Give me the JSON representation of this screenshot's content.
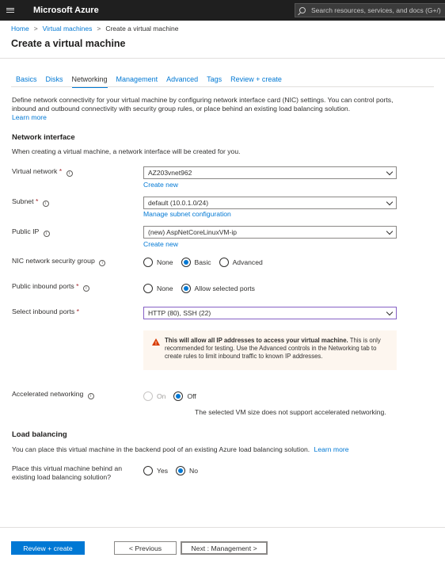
{
  "app": {
    "brand": "Microsoft Azure",
    "search_placeholder": "Search resources, services, and docs (G+/)"
  },
  "breadcrumb": [
    "Home",
    "Virtual machines",
    "Create a virtual machine"
  ],
  "page_title": "Create a virtual machine",
  "tabs": [
    {
      "label": "Basics",
      "active": false
    },
    {
      "label": "Disks",
      "active": false
    },
    {
      "label": "Networking",
      "active": true
    },
    {
      "label": "Management",
      "active": false
    },
    {
      "label": "Advanced",
      "active": false
    },
    {
      "label": "Tags",
      "active": false
    },
    {
      "label": "Review + create",
      "active": false
    }
  ],
  "intro": {
    "text": "Define network connectivity for your virtual machine by configuring network interface card (NIC) settings. You can control ports, inbound and outbound connectivity with security group rules, or place behind an existing load balancing solution.",
    "learn_more": "Learn more"
  },
  "network_interface": {
    "heading": "Network interface",
    "note": "When creating a virtual machine, a network interface will be created for you.",
    "virtual_network": {
      "label": "Virtual network",
      "value": "AZ203vnet962",
      "link": "Create new"
    },
    "subnet": {
      "label": "Subnet",
      "value": "default (10.0.1.0/24)",
      "link": "Manage subnet configuration"
    },
    "public_ip": {
      "label": "Public IP",
      "value": "(new) AspNetCoreLinuxVM-ip",
      "link": "Create new"
    },
    "nic_nsg": {
      "label": "NIC network security group",
      "options": [
        "None",
        "Basic",
        "Advanced"
      ],
      "selected": "Basic"
    },
    "public_inbound_ports": {
      "label": "Public inbound ports",
      "options": [
        "None",
        "Allow selected ports"
      ],
      "selected": "Allow selected ports"
    },
    "select_inbound_ports": {
      "label": "Select inbound ports",
      "value": "HTTP (80), SSH (22)"
    },
    "warning": {
      "bold": "This will allow all IP addresses to access your virtual machine.",
      "text": " This is only recommended for testing.  Use the Advanced controls in the Networking tab to create rules to limit inbound traffic to known IP addresses."
    },
    "accelerated_networking": {
      "label": "Accelerated networking",
      "options": [
        "On",
        "Off"
      ],
      "selected": "Off",
      "note": "The selected VM size does not support accelerated networking."
    }
  },
  "load_balancing": {
    "heading": "Load balancing",
    "note": "You can place this virtual machine in the backend pool of an existing Azure load balancing solution.",
    "learn_more": "Learn more",
    "question": {
      "label_line1": "Place this virtual machine behind an",
      "label_line2": "existing load balancing solution?",
      "options": [
        "Yes",
        "No"
      ],
      "selected": "No"
    }
  },
  "footer": {
    "review": "Review + create",
    "previous": "< Previous",
    "next": "Next : Management >"
  },
  "colors": {
    "accent": "#0078d4",
    "topbar": "#1f1f1f",
    "warning_bg": "#fdf6ef",
    "warning_icon": "#d83b01"
  }
}
